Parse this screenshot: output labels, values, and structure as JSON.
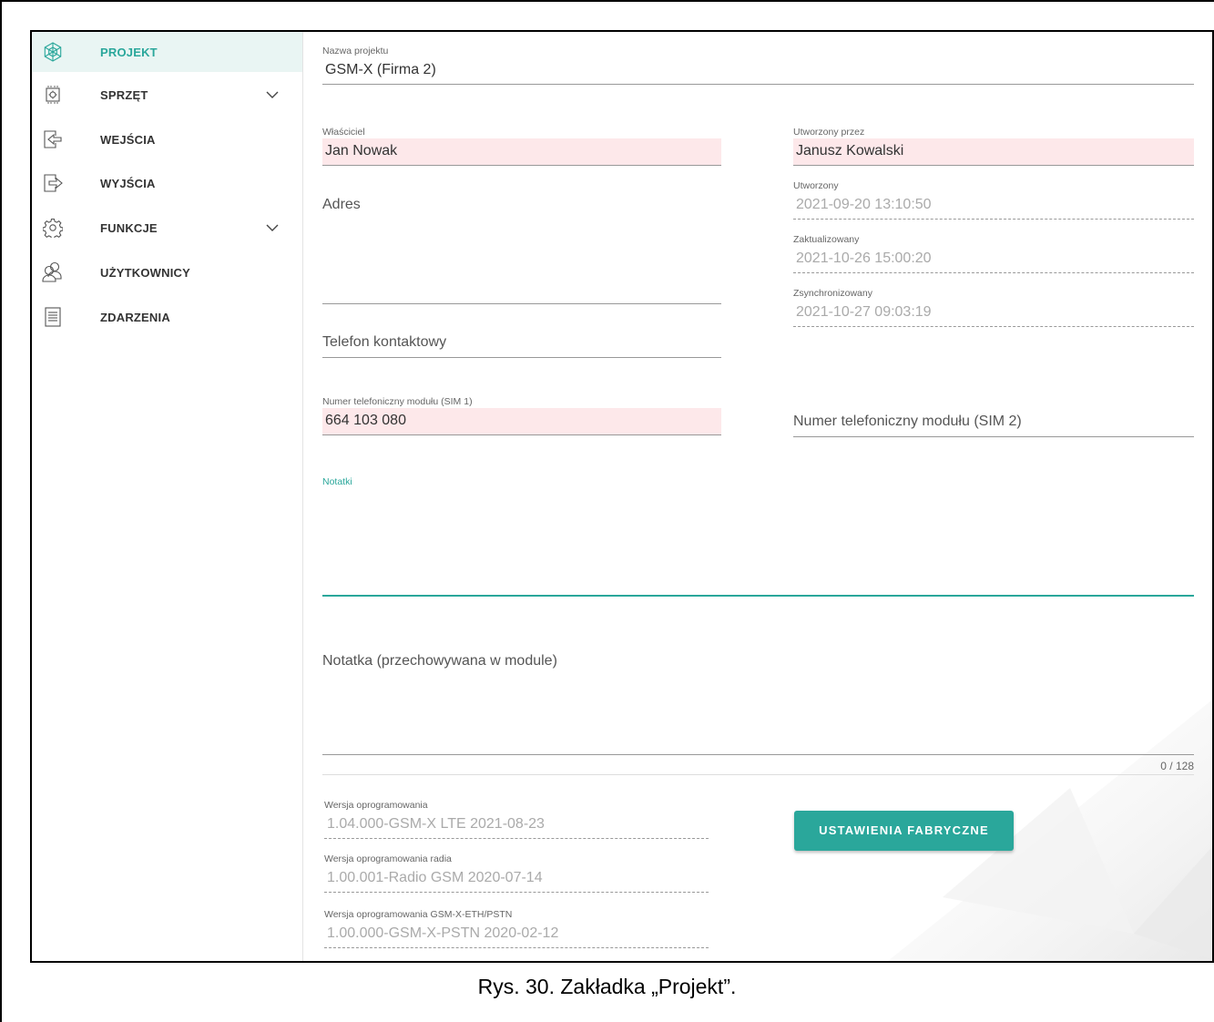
{
  "sidebar": {
    "items": [
      {
        "label": "PROJEKT",
        "icon": "project-icon"
      },
      {
        "label": "SPRZĘT",
        "icon": "hardware-icon"
      },
      {
        "label": "WEJŚCIA",
        "icon": "input-icon"
      },
      {
        "label": "WYJŚCIA",
        "icon": "output-icon"
      },
      {
        "label": "FUNKCJE",
        "icon": "gear-icon"
      },
      {
        "label": "UŻYTKOWNICY",
        "icon": "users-icon"
      },
      {
        "label": "ZDARZENIA",
        "icon": "events-icon"
      }
    ]
  },
  "form": {
    "project_name": {
      "label": "Nazwa projektu",
      "value": "GSM-X (Firma 2)"
    },
    "owner": {
      "label": "Właściciel",
      "value": "Jan Nowak"
    },
    "created_by": {
      "label": "Utworzony przez",
      "value": "Janusz Kowalski"
    },
    "address": {
      "placeholder": "Adres"
    },
    "created": {
      "label": "Utworzony",
      "value": "2021-09-20 13:10:50"
    },
    "updated": {
      "label": "Zaktualizowany",
      "value": "2021-10-26 15:00:20"
    },
    "synced": {
      "label": "Zsynchronizowany",
      "value": "2021-10-27 09:03:19"
    },
    "contact_phone": {
      "placeholder": "Telefon kontaktowy"
    },
    "sim1": {
      "label": "Numer telefoniczny modułu (SIM 1)",
      "value": "664 103 080"
    },
    "sim2": {
      "placeholder": "Numer telefoniczny modułu (SIM 2)"
    },
    "notes": {
      "label": "Notatki"
    },
    "module_note": {
      "placeholder": "Notatka (przechowywana w module)",
      "counter": "0 / 128"
    },
    "fw_version": {
      "label": "Wersja oprogramowania",
      "value": "1.04.000-GSM-X LTE 2021-08-23"
    },
    "radio_version": {
      "label": "Wersja oprogramowania radia",
      "value": "1.00.001-Radio GSM 2020-07-14"
    },
    "eth_version": {
      "label": "Wersja oprogramowania GSM-X-ETH/PSTN",
      "value": "1.00.000-GSM-X-PSTN 2020-02-12"
    },
    "factory_button": "USTAWIENIA FABRYCZNE"
  },
  "caption": "Rys. 30. Zakładka „Projekt”.",
  "colors": {
    "accent": "#2aa79b",
    "required_bg": "#fde8ea"
  }
}
